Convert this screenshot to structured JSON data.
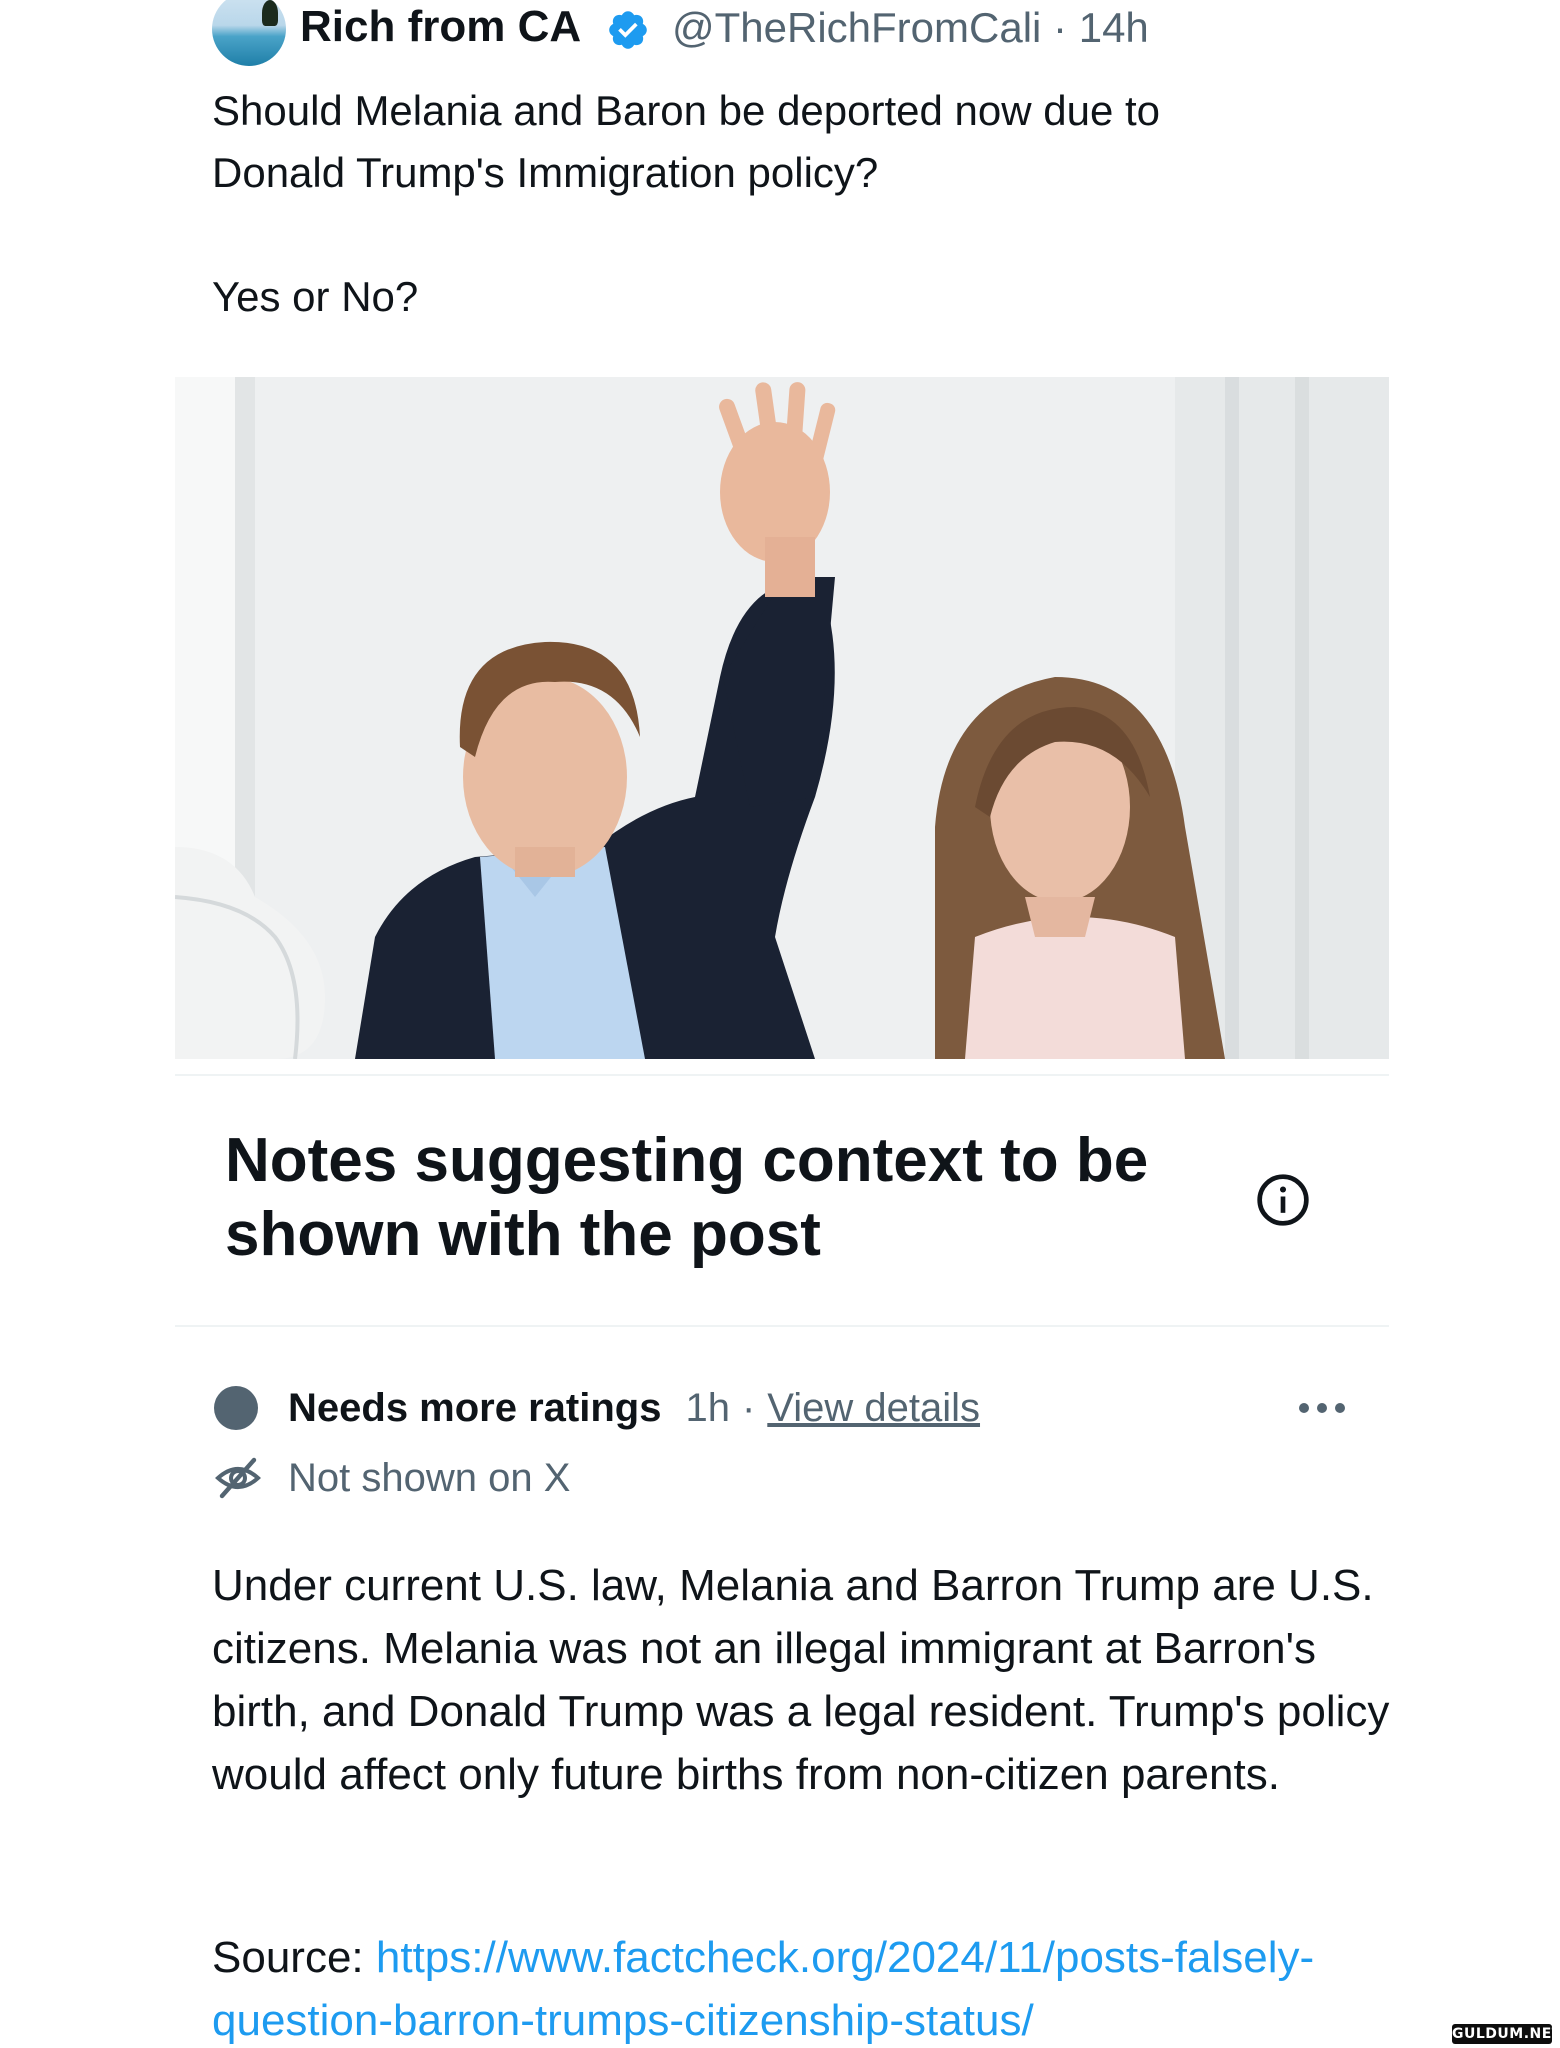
{
  "tweet": {
    "author_name": "Rich from CA",
    "handle": "@TheRichFromCali",
    "separator": "·",
    "time": "14h",
    "text_lines": [
      "Should Melania and Baron be deported now due to",
      "Donald Trump's Immigration policy?",
      "",
      "Yes or No?"
    ]
  },
  "notes": {
    "title": "Notes suggesting context to be shown with the post",
    "note": {
      "status": "Needs more ratings",
      "time": "1h",
      "separator": "·",
      "view_details": "View details",
      "visibility": "Not shown on X",
      "body": "Under current U.S. law, Melania and Barron Trump are U.S. citizens. Melania was not an illegal immigrant at Barron's birth, and Donald Trump was a legal resident. Trump's policy would affect only future births from non-citizen parents.",
      "source_label": "Source:",
      "source_url": "https://www.factcheck.org/2024/11/posts-falsely-question-barron-trumps-citizenship-status/"
    }
  },
  "watermark": "GULDUM.NET",
  "colors": {
    "text_primary": "#0f1419",
    "text_secondary": "#536471",
    "link": "#1d9bf0",
    "verified": "#1d9bf0",
    "status_dot": "#536471"
  },
  "icons": [
    "verified-badge-icon",
    "info-icon",
    "more-icon",
    "eye-off-icon"
  ]
}
